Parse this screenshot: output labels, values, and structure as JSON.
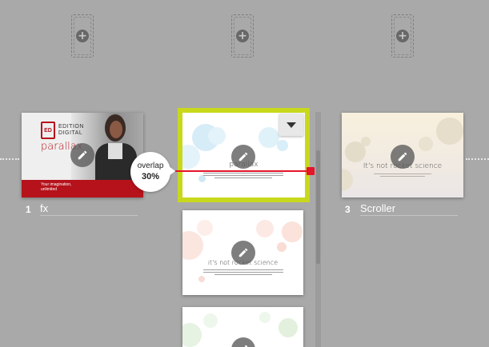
{
  "slots": [
    {
      "icon": "plus-icon"
    },
    {
      "icon": "plus-icon"
    },
    {
      "icon": "plus-icon"
    }
  ],
  "slides": [
    {
      "number": "1",
      "name": "fx"
    },
    {
      "number": "",
      "name": ""
    },
    {
      "number": "3",
      "name": "Scroller"
    }
  ],
  "slide1": {
    "brand_line1": "EDITION",
    "brand_line2": "DIGITAL",
    "logo_letters": "ED",
    "title": "parallax",
    "tagline_line1": "Your imagination,",
    "tagline_line2": "unlimited"
  },
  "slide2": {
    "title": "parallax"
  },
  "slide3": {
    "title": "It's not rocket science"
  },
  "substack_slide": {
    "title": "it's not rocket science"
  },
  "overlap": {
    "label": "overlap",
    "value": "30%"
  },
  "colors": {
    "background": "#a9a9a9",
    "selection": "#c8d81c",
    "overlap_line": "#e5152a",
    "brand_red": "#b5121b"
  }
}
